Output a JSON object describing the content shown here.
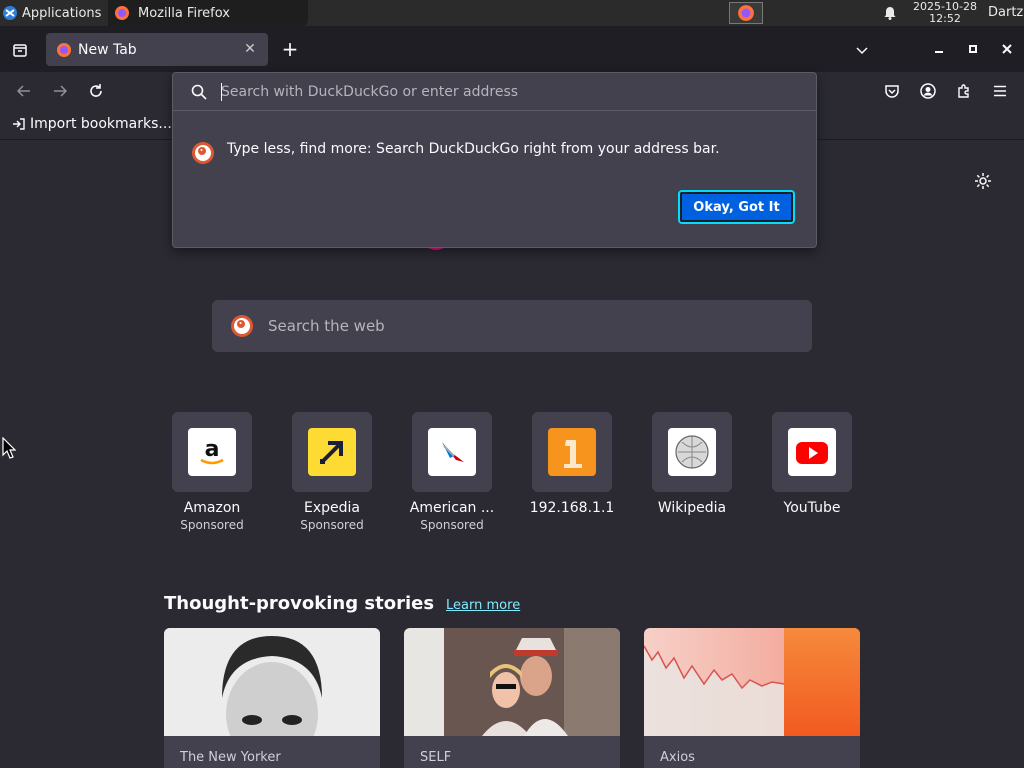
{
  "taskbar": {
    "applications_label": "Applications",
    "window_title": "Mozilla Firefox",
    "clock_date": "2025-10-28",
    "clock_time": "12:52",
    "user": "Dartz"
  },
  "tab": {
    "title": "New Tab"
  },
  "bookmarks": {
    "import_label": "Import bookmarks..."
  },
  "urlbar": {
    "placeholder": "Search with DuckDuckGo or enter address",
    "tip_text": "Type less, find more: Search DuckDuckGo right from your address bar.",
    "ok_button": "Okay, Got It"
  },
  "search": {
    "placeholder": "Search the web"
  },
  "top_sites": [
    {
      "label": "Amazon",
      "sponsored": "Sponsored"
    },
    {
      "label": "Expedia",
      "sponsored": "Sponsored"
    },
    {
      "label": "American ...",
      "sponsored": "Sponsored"
    },
    {
      "label": "192.168.1.1",
      "sponsored": ""
    },
    {
      "label": "Wikipedia",
      "sponsored": ""
    },
    {
      "label": "YouTube",
      "sponsored": ""
    }
  ],
  "stories": {
    "heading": "Thought-provoking stories",
    "learn_more": "Learn more",
    "cards": [
      {
        "source": "The New Yorker"
      },
      {
        "source": "SELF"
      },
      {
        "source": "Axios"
      }
    ]
  },
  "colors": {
    "accent": "#0061e0",
    "background": "#2b2a33",
    "panel": "#42414d",
    "link": "#80ebff"
  }
}
